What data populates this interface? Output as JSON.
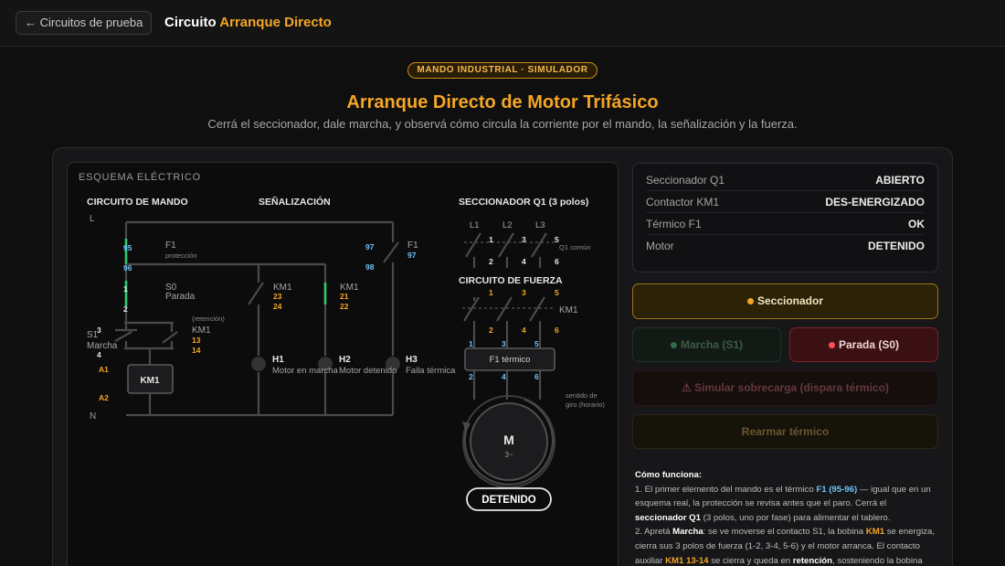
{
  "topbar": {
    "back": "← Circuitos de prueba",
    "title_prefix": "Circuito",
    "title_accent": "Arranque Directo"
  },
  "hero": {
    "badge": "MANDO INDUSTRIAL · SIMULADOR",
    "title": "Arranque Directo de Motor Trifásico",
    "subtitle": "Cerrá el seccionador, dale marcha, y observá cómo circula la corriente por el mando, la señalización y la fuerza."
  },
  "schema": {
    "label": "ESQUEMA ELÉCTRICO",
    "sections": {
      "mando": "CIRCUITO DE MANDO",
      "senal": "SEÑALIZACIÓN",
      "secc": "SECCIONADOR Q1 (3 polos)",
      "fuerza": "CIRCUITO DE FUERZA"
    },
    "rails": {
      "l": "L",
      "n": "N"
    },
    "f1": {
      "t95": "95",
      "t96": "96",
      "name": "F1",
      "desc": "protección"
    },
    "s0": {
      "t1": "1",
      "t2": "2",
      "name": "S0",
      "desc": "Parada"
    },
    "s1": {
      "t3": "3",
      "t4": "4",
      "name": "S1",
      "desc": "Marcha"
    },
    "retencion": {
      "note": "(retención)",
      "name": "KM1",
      "t13": "13",
      "t14": "14"
    },
    "coil": {
      "a1": "A1",
      "a2": "A2",
      "name": "KM1"
    },
    "km1_no": {
      "name": "KM1",
      "t23": "23",
      "t24": "24"
    },
    "km1_nc": {
      "name": "KM1",
      "t21": "21",
      "t22": "22"
    },
    "f1_sig": {
      "t97": "97",
      "t98": "98",
      "name": "F1",
      "t97b": "97"
    },
    "lamps": {
      "h1": "H1",
      "h1_desc": "Motor en marcha",
      "h2": "H2",
      "h2_desc": "Motor detenido",
      "h3": "H3",
      "h3_desc": "Falla térmica"
    },
    "q1": {
      "l1": "L1",
      "l2": "L2",
      "l3": "L3",
      "top": [
        "1",
        "3",
        "5"
      ],
      "bottom": [
        "2",
        "4",
        "6"
      ],
      "note": "Q1 común"
    },
    "km1_power": {
      "name": "KM1",
      "top": [
        "1",
        "3",
        "5"
      ],
      "bottom": [
        "2",
        "4",
        "6"
      ]
    },
    "thermal": {
      "name": "F1 térmico",
      "top": [
        "1",
        "3",
        "5"
      ],
      "bottom": [
        "2",
        "4",
        "6"
      ]
    },
    "motor": {
      "symbol": "M",
      "phase": "3~",
      "rot1": "sentido de",
      "rot2": "giro (horario)",
      "state": "DETENIDO"
    }
  },
  "status": [
    {
      "key": "Seccionador Q1",
      "value": "ABIERTO"
    },
    {
      "key": "Contactor KM1",
      "value": "DES-ENERGIZADO"
    },
    {
      "key": "Térmico F1",
      "value": "OK"
    },
    {
      "key": "Motor",
      "value": "DETENIDO"
    }
  ],
  "buttons": {
    "seccionador": "Seccionador",
    "marcha": "Marcha (S1)",
    "parada": "Parada (S0)",
    "sobrecarga": "⚠ Simular sobrecarga (dispara térmico)",
    "rearmar": "Rearmar térmico"
  },
  "howto": {
    "title": "Cómo funciona:",
    "p1a": "1. El primer elemento del mando es el térmico ",
    "p1b": "F1 (95-96)",
    "p1c": " — igual que en un esquema real, la protección se revisa antes que el paro. Cerrá el ",
    "p1d": "seccionador Q1",
    "p1e": " (3 polos, uno por fase) para alimentar el tablero.",
    "p2a": "2. Apretá ",
    "p2b": "Marcha",
    "p2c": ": se ve moverse el contacto S1, la bobina ",
    "p2d": "KM1",
    "p2e": " se energiza, cierra sus 3 polos de fuerza (1-2, 3-4, 5-6) y el motor arranca. El contacto auxiliar ",
    "p2f": "KM1 13-14",
    "p2g": " se cierra y queda en ",
    "p2h": "retención",
    "p2i": ", sosteniendo la bobina"
  },
  "colors": {
    "accent": "#f5a623",
    "terminal_blue": "#6ec3f7",
    "closed_green": "#2ecc71",
    "secc_dot": "#f5a623",
    "marcha_dot": "#2e6b45",
    "parada_dot": "#ff4d5a"
  }
}
